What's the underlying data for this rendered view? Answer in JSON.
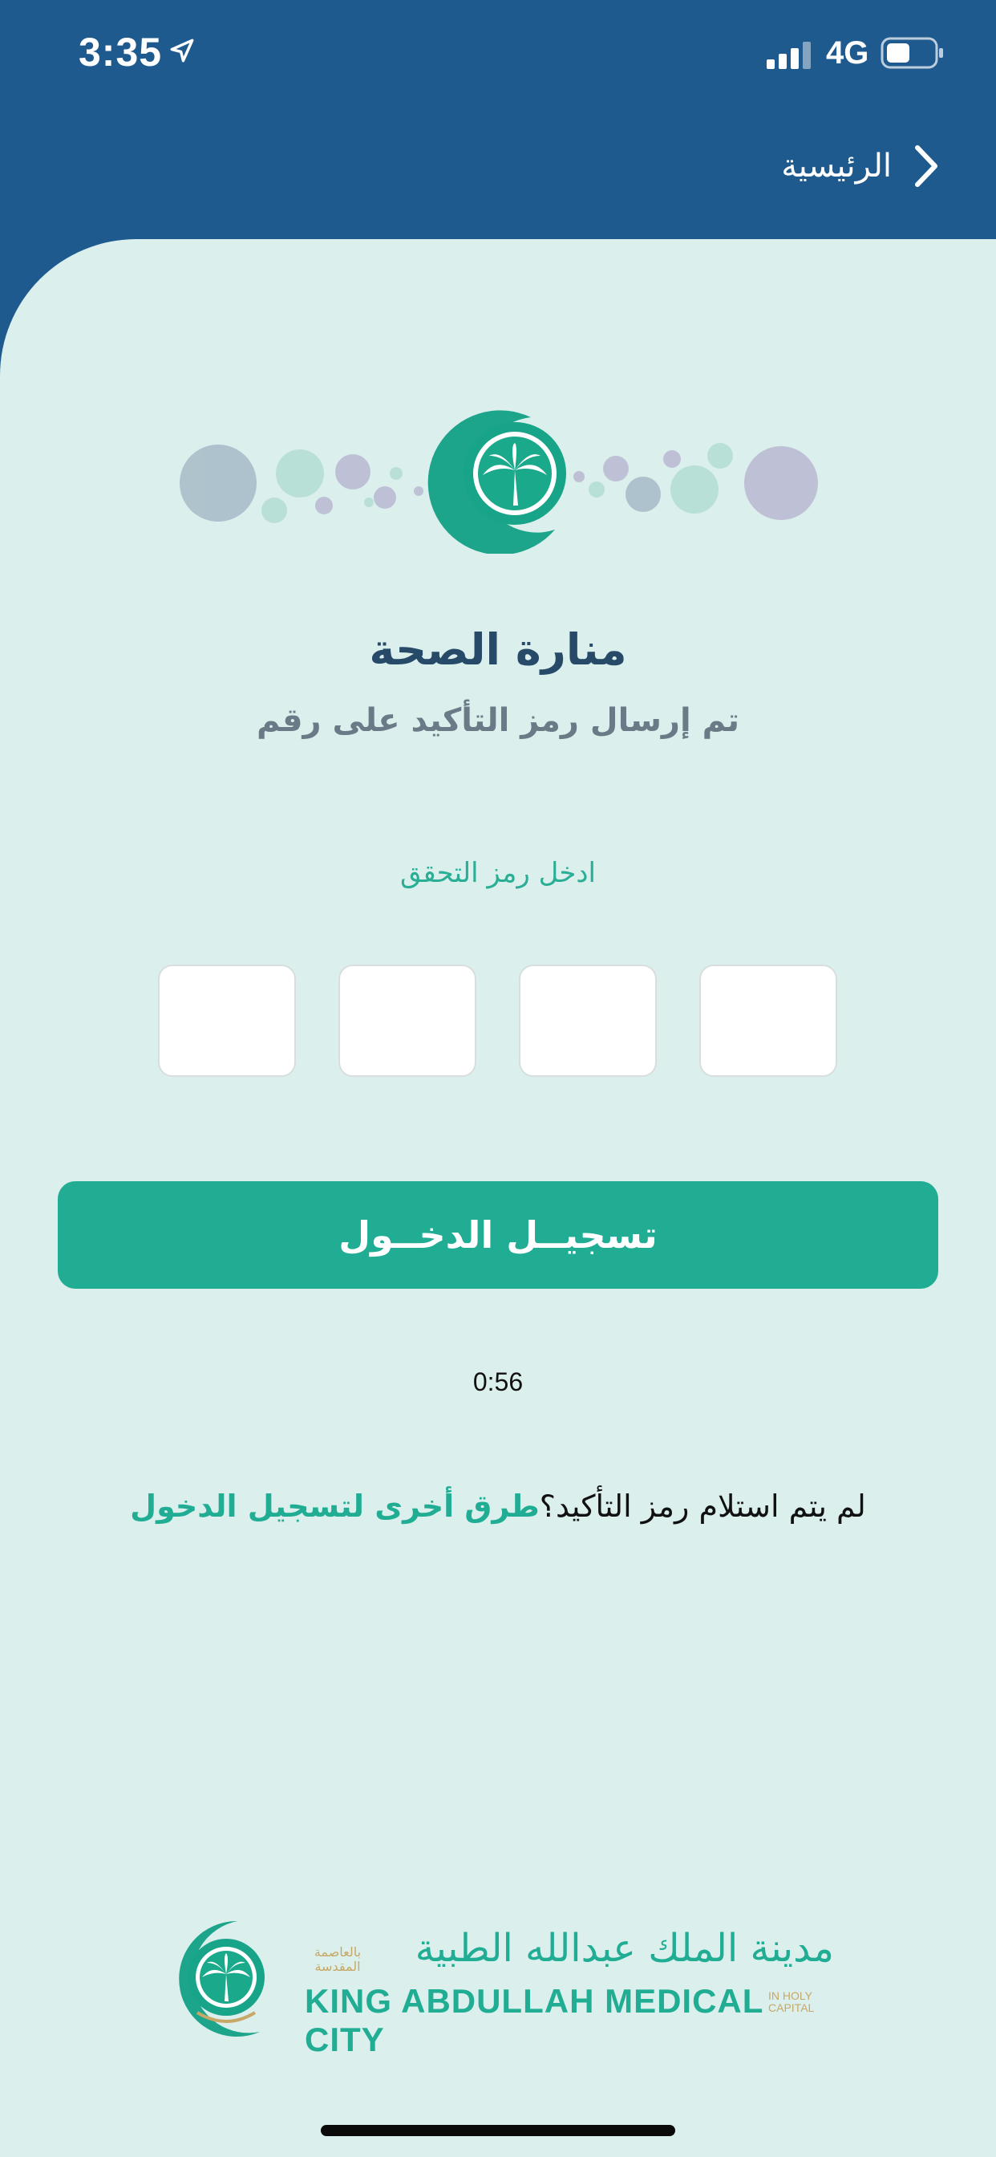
{
  "status": {
    "time": "3:35",
    "network": "4G"
  },
  "nav": {
    "back_label": "الرئيسية"
  },
  "header": {
    "title": "منارة الصحة",
    "subtitle": "تم إرسال رمز التأكيد على رقم"
  },
  "otp": {
    "label": "ادخل رمز التحقق",
    "digits": [
      "",
      "",
      "",
      ""
    ]
  },
  "login_button": "تسجيــل الدخــول",
  "timer": "0:56",
  "help": {
    "text": "لم يتم استلام رمز التأكيد؟",
    "link": "طرق أخرى لتسجيل الدخول"
  },
  "footer": {
    "name_ar": "مدينة الملك عبدالله الطبية",
    "name_en": "KING ABDULLAH MEDICAL CITY",
    "tag_ar": "بالعاصمة المقدسة",
    "tag_en": "IN HOLY CAPITAL"
  },
  "colors": {
    "primary_blue": "#1f5a8e",
    "accent_green": "#21ad94",
    "background": "#dbefed"
  }
}
